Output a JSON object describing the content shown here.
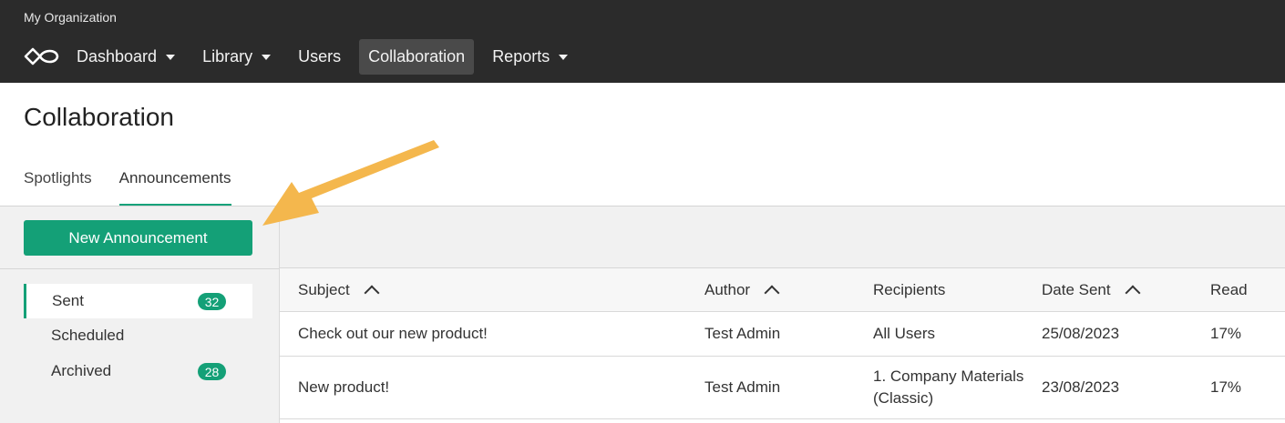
{
  "org_name": "My Organization",
  "nav": {
    "items": [
      {
        "label": "Dashboard"
      },
      {
        "label": "Library"
      },
      {
        "label": "Users"
      },
      {
        "label": "Collaboration"
      },
      {
        "label": "Reports"
      }
    ]
  },
  "page": {
    "title": "Collaboration",
    "tabs": [
      {
        "label": "Spotlights"
      },
      {
        "label": "Announcements"
      }
    ]
  },
  "sidebar": {
    "new_button": "New Announcement",
    "folders": [
      {
        "label": "Sent",
        "count": "32"
      },
      {
        "label": "Scheduled"
      },
      {
        "label": "Archived",
        "count": "28"
      }
    ]
  },
  "table": {
    "columns": [
      "Subject",
      "Author",
      "Recipients",
      "Date Sent",
      "Read"
    ],
    "rows": [
      {
        "subject": "Check out our new product!",
        "author": "Test Admin",
        "recipients": "All Users",
        "date_sent": "25/08/2023",
        "read": "17%"
      },
      {
        "subject": "New product!",
        "author": "Test Admin",
        "recipients": "1. Company Materials (Classic)",
        "date_sent": "23/08/2023",
        "read": "17%"
      }
    ]
  },
  "colors": {
    "accent": "#14a077",
    "topbar": "#2b2b2b",
    "annotation_arrow": "#f4b74d"
  },
  "icons": {
    "logo": "infinity-logo-icon",
    "dropdown": "caret-down-icon",
    "sort": "chevron-up-icon",
    "annotation": "arrow-annotation-icon"
  }
}
